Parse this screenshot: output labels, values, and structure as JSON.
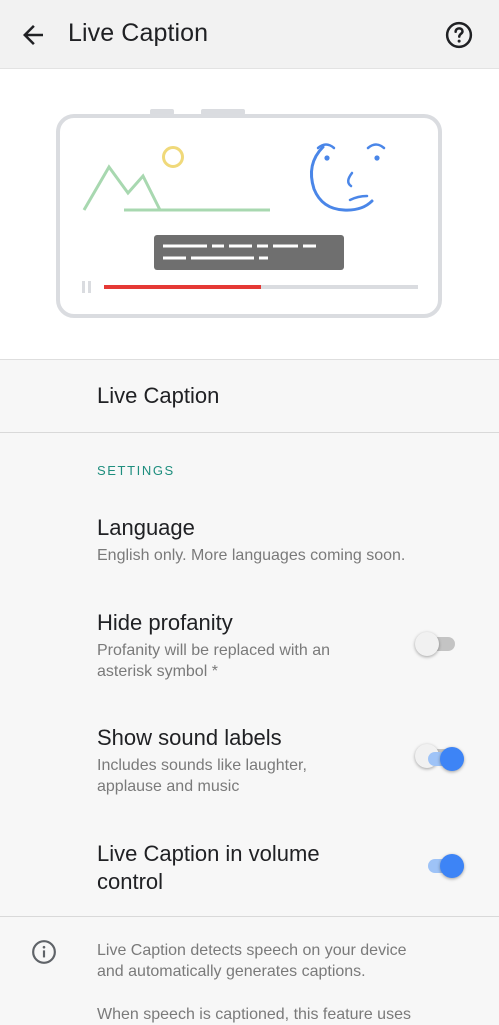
{
  "appbar": {
    "title": "Live Caption",
    "back_icon": "arrow-back-icon",
    "help_icon": "help-circle-icon"
  },
  "illustration": {
    "name": "live-caption-illustration",
    "colors": {
      "frame": "#dadce0",
      "mountains": "#a8d8b0",
      "sun": "#f0d97a",
      "face": "#4a86e8",
      "caption_box": "#6f6f6f",
      "progress": "#e53935",
      "progress_track": "#dadce0"
    },
    "progress_fraction": 0.5
  },
  "main_toggle": {
    "label": "Live Caption",
    "on": false
  },
  "section": {
    "header": "SETTINGS"
  },
  "settings": [
    {
      "title": "Language",
      "summary": "English only. More languages coming soon."
    },
    {
      "title": "Hide profanity",
      "summary_line1": "Profanity will be replaced with an",
      "summary_line2": "asterisk symbol *",
      "on": false
    },
    {
      "title": "Show sound labels",
      "summary_line1": "Includes sounds like laughter,",
      "summary_line2": "applause and music",
      "on": true
    },
    {
      "title_line1": "Live Caption in volume",
      "title_line2": "control",
      "on": true
    }
  ],
  "info": {
    "icon": "info-icon",
    "text_line1": "Live Caption detects speech on your device",
    "text_line2": "and automatically generates captions.",
    "text2": "When speech is captioned, this feature uses"
  },
  "colors": {
    "accent": "#3d84f6",
    "section_header": "#1e8e7e",
    "summary_text": "#7a7a7a"
  }
}
